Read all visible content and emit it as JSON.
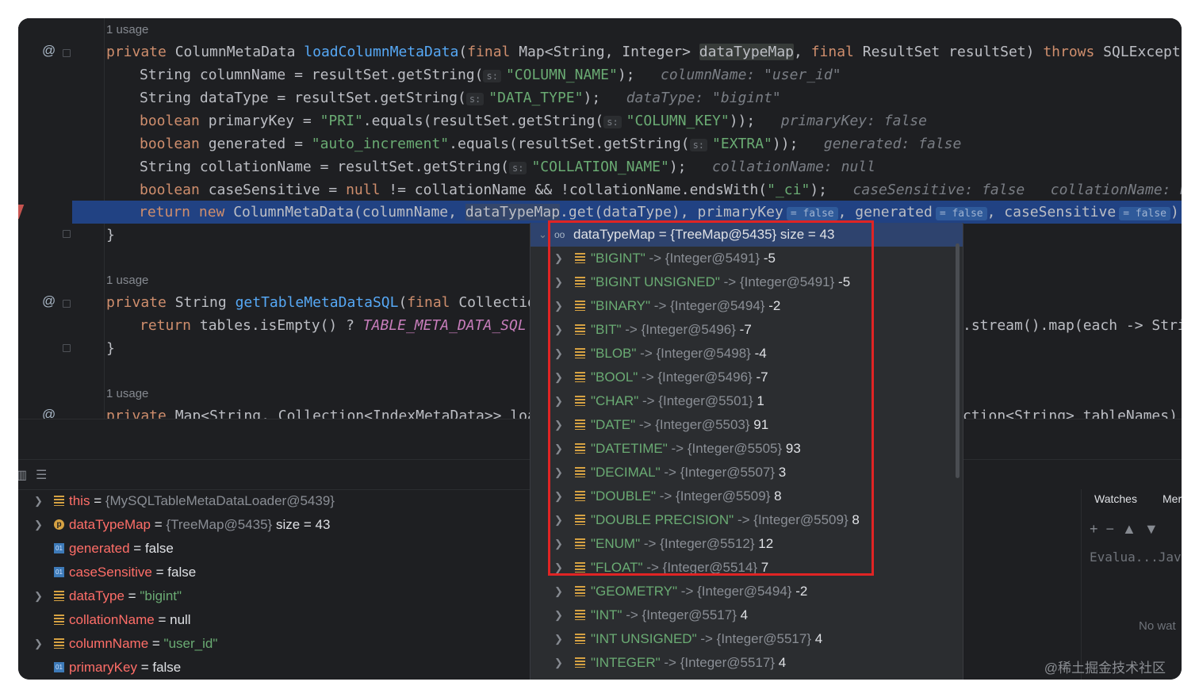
{
  "editor": {
    "usage1": "1 usage",
    "usage2": "1 usage",
    "usage3": "1 usage",
    "line1": {
      "a": "private ",
      "b": "ColumnMetaData ",
      "c": "loadColumnMetaData",
      "d": "(",
      "e": "final ",
      "f": "Map<String, Integer> ",
      "g": "dataTypeMap",
      "h": ", ",
      "i": "final ",
      "j": "ResultSet resultSet) ",
      "k": "throws ",
      "l": "SQLException {"
    },
    "line2": {
      "a": "String columnName = resultSet.getString(",
      "p": "s:",
      "s": "\"COLUMN_NAME\"",
      "e": ");",
      "h": "columnName: \"user_id\""
    },
    "line3": {
      "a": "String dataType = resultSet.getString(",
      "p": "s:",
      "s": "\"DATA_TYPE\"",
      "e": ");",
      "h": "dataType: \"bigint\""
    },
    "line4": {
      "k": "boolean ",
      "a": "primaryKey = ",
      "s1": "\"PRI\"",
      "b": ".equals(resultSet.getString(",
      "p": "s:",
      "s2": "\"COLUMN_KEY\"",
      "e": "));",
      "h": "primaryKey: false"
    },
    "line5": {
      "k": "boolean ",
      "a": "generated = ",
      "s1": "\"auto_increment\"",
      "b": ".equals(resultSet.getString(",
      "p": "s:",
      "s2": "\"EXTRA\"",
      "e": "));",
      "h": "generated: false"
    },
    "line6": {
      "a": "String collationName = resultSet.getString(",
      "p": "s:",
      "s": "\"COLLATION_NAME\"",
      "e": ");",
      "h": "collationName: null"
    },
    "line7": {
      "k": "boolean ",
      "a": "caseSensitive = ",
      "k2": "null",
      "b": " != collationName && !collationName.endsWith(",
      "s": "\"_ci\"",
      "e": ");",
      "h1": "caseSensitive: false",
      "h2": "collationName: null"
    },
    "line8": {
      "k": "return new ",
      "a": "ColumnMetaData(columnName, ",
      "b": "dataTypeMap",
      "c": ".get(dataType), primaryKey",
      "p1": "= false",
      "d": ", generated",
      "p2": "= false",
      "e": ", caseSensitive",
      "p3": "= false",
      "f": ");"
    },
    "line9": "}",
    "line10": {
      "a": "private ",
      "b": "String ",
      "c": "getTableMetaDataSQL",
      "d": "(",
      "e": "final ",
      "f": "Collection<"
    },
    "line11": {
      "k": "return ",
      "a": "tables.isEmpty() ? ",
      "c": "TABLE_META_DATA_SQL",
      "b": " :",
      "r": ".stream().map(each -> Stri"
    },
    "line12": "}",
    "line13": {
      "a": "private ",
      "b": "Map<String, Collection<IndexMetaData>> load",
      "r": "ction<String> tableNames) {"
    }
  },
  "variables": [
    {
      "expand": true,
      "icon": "list",
      "name": "this",
      "eq": " = ",
      "ref": "{MySQLTableMetaDataLoader@5439}",
      "val": ""
    },
    {
      "expand": true,
      "icon": "p",
      "name": "dataTypeMap",
      "eq": " = ",
      "ref": "{TreeMap@5435}",
      "val": "  size = 43"
    },
    {
      "expand": false,
      "icon": "01",
      "name": "generated",
      "eq": " = ",
      "ref": "",
      "val": "false"
    },
    {
      "expand": false,
      "icon": "01",
      "name": "caseSensitive",
      "eq": " = ",
      "ref": "",
      "val": "false"
    },
    {
      "expand": true,
      "icon": "list",
      "name": "dataType",
      "eq": " = ",
      "ref": "",
      "val": "",
      "str": "\"bigint\""
    },
    {
      "expand": false,
      "icon": "list",
      "name": "collationName",
      "eq": " = ",
      "ref": "",
      "val": "null"
    },
    {
      "expand": true,
      "icon": "list",
      "name": "columnName",
      "eq": " = ",
      "ref": "",
      "val": "",
      "str": "\"user_id\""
    },
    {
      "expand": false,
      "icon": "01",
      "name": "primaryKey",
      "eq": " = ",
      "ref": "",
      "val": "false"
    }
  ],
  "popup": {
    "root": "dataTypeMap = {TreeMap@5435}  size = 43",
    "entries": [
      {
        "key": "\"BIGINT\"",
        "ref": "{Integer@5491}",
        "val": "-5"
      },
      {
        "key": "\"BIGINT UNSIGNED\"",
        "ref": "{Integer@5491}",
        "val": "-5"
      },
      {
        "key": "\"BINARY\"",
        "ref": "{Integer@5494}",
        "val": "-2"
      },
      {
        "key": "\"BIT\"",
        "ref": "{Integer@5496}",
        "val": "-7"
      },
      {
        "key": "\"BLOB\"",
        "ref": "{Integer@5498}",
        "val": "-4"
      },
      {
        "key": "\"BOOL\"",
        "ref": "{Integer@5496}",
        "val": "-7"
      },
      {
        "key": "\"CHAR\"",
        "ref": "{Integer@5501}",
        "val": "1"
      },
      {
        "key": "\"DATE\"",
        "ref": "{Integer@5503}",
        "val": "91"
      },
      {
        "key": "\"DATETIME\"",
        "ref": "{Integer@5505}",
        "val": "93"
      },
      {
        "key": "\"DECIMAL\"",
        "ref": "{Integer@5507}",
        "val": "3"
      },
      {
        "key": "\"DOUBLE\"",
        "ref": "{Integer@5509}",
        "val": "8"
      },
      {
        "key": "\"DOUBLE PRECISION\"",
        "ref": "{Integer@5509}",
        "val": "8"
      },
      {
        "key": "\"ENUM\"",
        "ref": "{Integer@5512}",
        "val": "12"
      },
      {
        "key": "\"FLOAT\"",
        "ref": "{Integer@5514}",
        "val": "7"
      },
      {
        "key": "\"GEOMETRY\"",
        "ref": "{Integer@5494}",
        "val": "-2"
      },
      {
        "key": "\"INT\"",
        "ref": "{Integer@5517}",
        "val": "4"
      },
      {
        "key": "\"INT UNSIGNED\"",
        "ref": "{Integer@5517}",
        "val": "4"
      },
      {
        "key": "\"INTEGER\"",
        "ref": "{Integer@5517}",
        "val": "4"
      }
    ],
    "arrow": " -> "
  },
  "watches": {
    "tab1": "Watches",
    "tab2": "Mer",
    "eval_placeholder": "Evalua...Jav",
    "empty": "No wat"
  },
  "watermark": "@稀土掘金技术社区",
  "colors": {
    "accent": "#214283",
    "highlight_box": "#e02424",
    "string": "#6aab73",
    "keyword": "#cf8e6d",
    "var_name": "#ff6e68"
  }
}
